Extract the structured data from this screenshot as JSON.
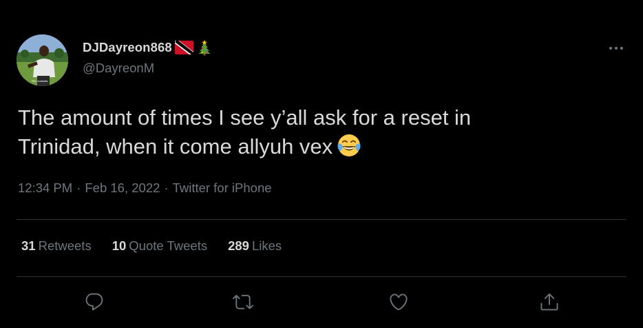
{
  "tweet": {
    "author": {
      "display_name": "DJDayreon868",
      "handle": "@DayreonM",
      "badges": [
        "trinidad-tobago-flag-icon",
        "christmas-tree-icon"
      ]
    },
    "text_line1": "The amount of times I see y’all ask for a reset in",
    "text_line2": "Trinidad, when it come allyuh vex",
    "emoji": "face-with-tears-of-joy-icon",
    "time": "12:34 PM",
    "date": "Feb 16, 2022",
    "separator": "·",
    "source": "Twitter for iPhone",
    "stats": {
      "retweets_count": "31",
      "retweets_label": "Retweets",
      "quotes_count": "10",
      "quotes_label": "Quote Tweets",
      "likes_count": "289",
      "likes_label": "Likes"
    },
    "actions": [
      "reply-icon",
      "retweet-icon",
      "like-icon",
      "share-icon"
    ]
  },
  "colors": {
    "background": "#000000",
    "text_primary": "#d9d9d9",
    "text_secondary": "#6e767d",
    "divider": "#2f3336"
  }
}
